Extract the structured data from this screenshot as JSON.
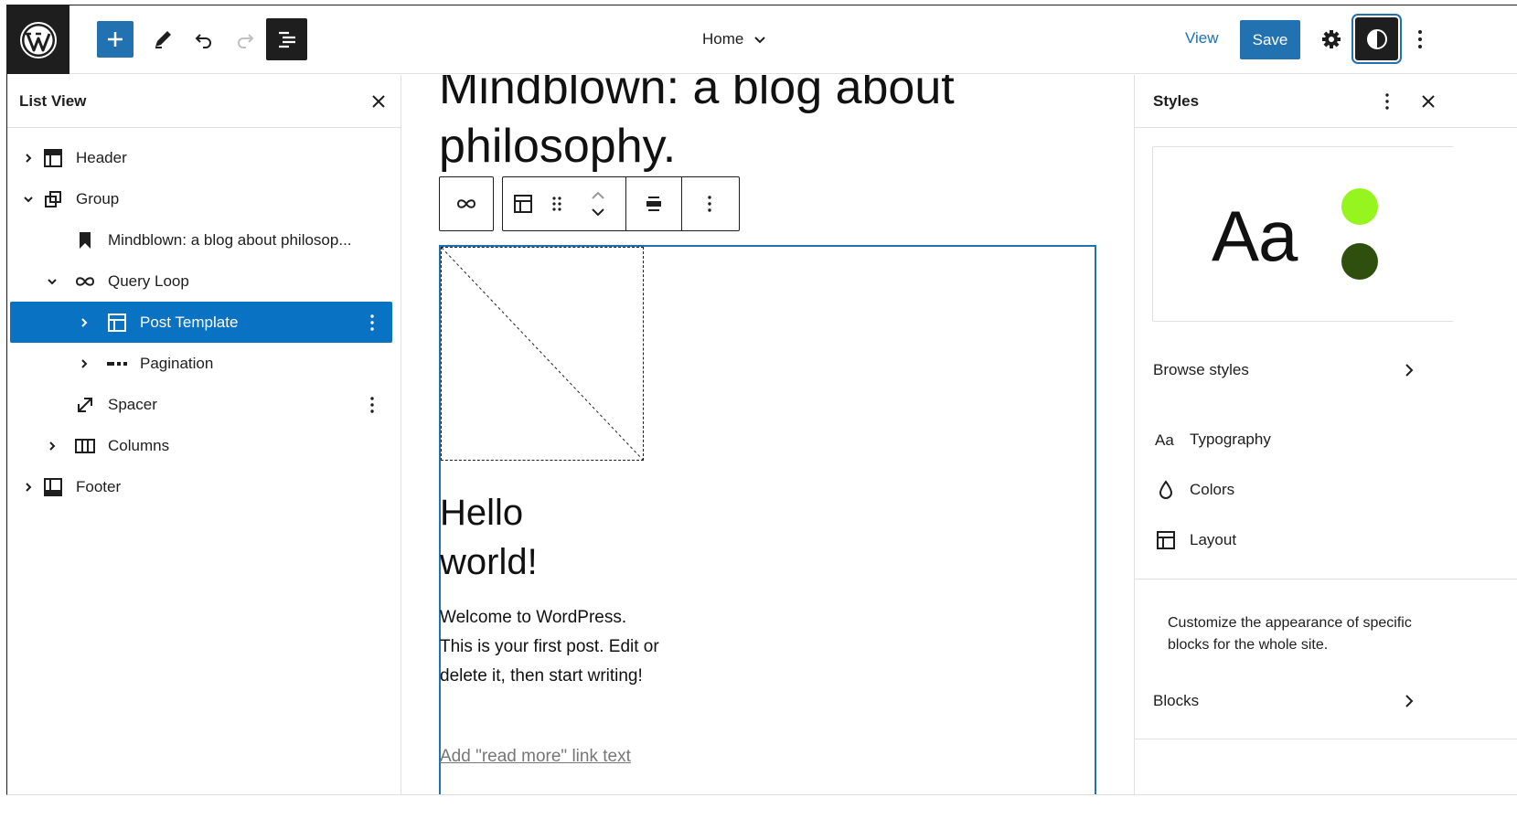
{
  "topbar": {
    "document_title": "Home",
    "view_label": "View",
    "save_label": "Save"
  },
  "list_view": {
    "title": "List View",
    "items": [
      {
        "label": "Header"
      },
      {
        "label": "Group"
      },
      {
        "label": "Mindblown: a blog about philosop..."
      },
      {
        "label": "Query Loop"
      },
      {
        "label": "Post Template"
      },
      {
        "label": "Pagination"
      },
      {
        "label": "Spacer"
      },
      {
        "label": "Columns"
      },
      {
        "label": "Footer"
      }
    ]
  },
  "canvas": {
    "site_heading": "Mindblown: a blog about philosophy.",
    "post_title": "Hello world!",
    "post_excerpt": "Welcome to WordPress. This is your first post. Edit or delete it, then start writing!",
    "read_more": "Add \"read more\" link text"
  },
  "styles_panel": {
    "title": "Styles",
    "preview_text": "Aa",
    "preview_colors": [
      "#97f51f",
      "#2f4f0e"
    ],
    "browse_styles": "Browse styles",
    "tools": [
      {
        "label": "Typography",
        "icon": "typography-icon"
      },
      {
        "label": "Colors",
        "icon": "droplet-icon"
      },
      {
        "label": "Layout",
        "icon": "layout-icon"
      }
    ],
    "blocks_description": "Customize the appearance of specific blocks for the whole site.",
    "blocks_label": "Blocks"
  },
  "colors": {
    "accent": "#2271b1",
    "selected_row": "#0a72c3",
    "dark": "#1e1e1e"
  }
}
